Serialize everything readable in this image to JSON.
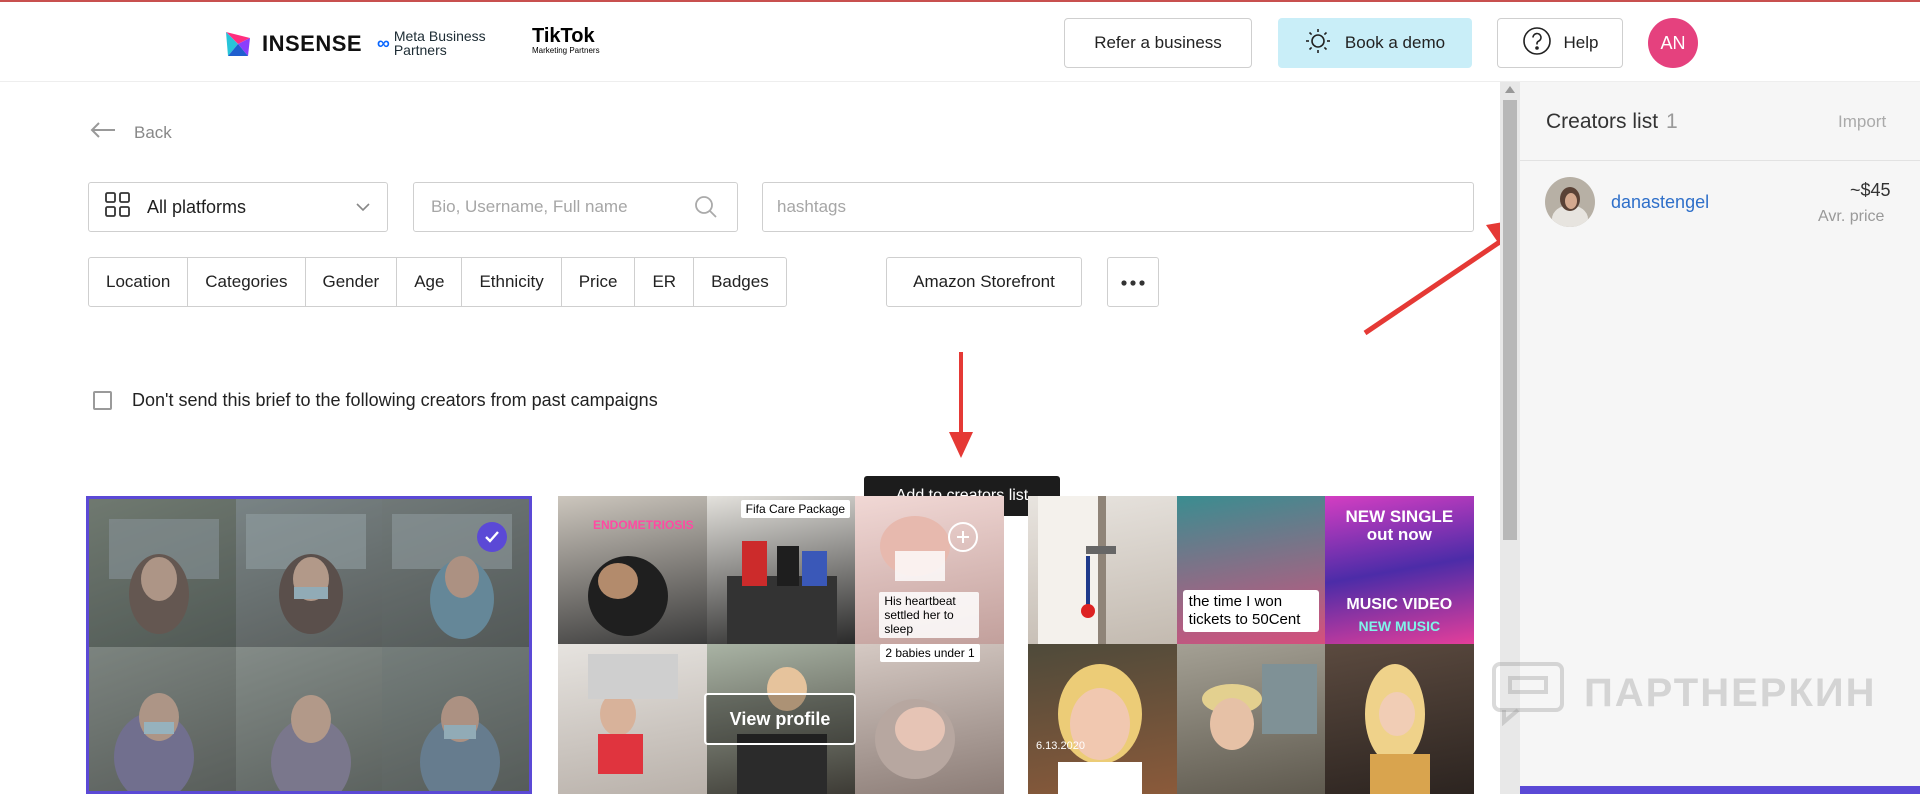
{
  "header": {
    "brand": "INSENSE",
    "meta_partner": "Meta Business Partners",
    "meta_line1": "Meta Business",
    "meta_line2": "Partners",
    "tiktok": "TikTok",
    "tiktok_sub": "Marketing Partners",
    "refer_label": "Refer a business",
    "demo_label": "Book a demo",
    "help_label": "Help",
    "avatar_initials": "AN"
  },
  "nav": {
    "back_label": "Back"
  },
  "search": {
    "platform_value": "All platforms",
    "query_placeholder": "Bio, Username, Full name",
    "hashtags_placeholder": "hashtags"
  },
  "filters": [
    "Location",
    "Categories",
    "Gender",
    "Age",
    "Ethnicity",
    "Price",
    "ER",
    "Badges"
  ],
  "amazon_label": "Amazon Storefront",
  "exclude_checkbox": {
    "label": "Don't send this brief to the following creators from past campaigns",
    "checked": false
  },
  "tooltip": "Add to creators list",
  "cards": {
    "view_profile_label": "View profile",
    "card2_captions": [
      "ENDOMETRIOSIS",
      "Fifa Care Package",
      "His heartbeat settled her to sleep",
      "2 babies under 1"
    ],
    "card3_captions": [
      "the time I won tickets to 50Cent",
      "NEW SINGLE out now",
      "MUSIC VIDEO",
      "NEW MUSIC",
      "6.13.2020"
    ]
  },
  "creators_panel": {
    "title": "Creators list",
    "count": "1",
    "import_label": "Import",
    "creator": {
      "username": "danastengel",
      "price": "~$45",
      "price_label": "Avr. price"
    }
  },
  "watermark": "ПАРТНЕРКИН",
  "colors": {
    "accent": "#5b49d6",
    "avatar": "#e5417e",
    "demo_bg": "#c9eef8",
    "link": "#2e6fc9",
    "annotation": "#e53935"
  }
}
